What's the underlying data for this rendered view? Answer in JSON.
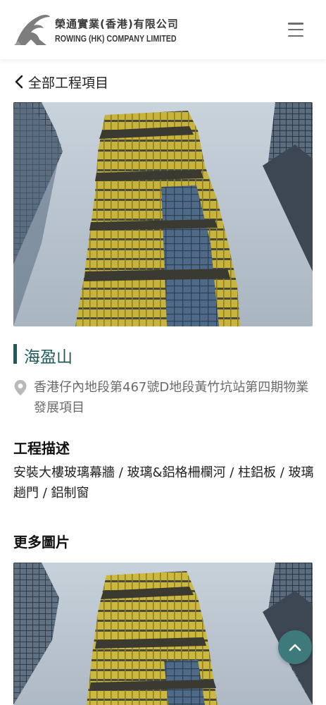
{
  "header": {
    "company_name_cn": "榮通實業(香港)有限公司",
    "company_name_en": "ROWING (HK) COMPANY LIMITED",
    "menu_icon": "hamburger-menu-icon"
  },
  "nav": {
    "back_label": "全部工程項目",
    "back_icon": "chevron-left-icon"
  },
  "project": {
    "title": "海盈山",
    "address": "香港仔內地段第467號D地段黃竹坑站第四期物業發展項目",
    "address_icon": "map-pin-icon",
    "description_heading": "工程描述",
    "description": "安裝大樓玻璃幕牆 / 玻璃&鋁格柵欄河 / 柱鋁板 / 玻璃趟門 / 鋁制窗",
    "more_images_heading": "更多圖片"
  },
  "scroll_top_icon": "chevron-up-icon",
  "colors": {
    "accent": "#1e5a5c",
    "scroll_button": "#3e7a7b",
    "address_text": "#6a6a6a"
  }
}
